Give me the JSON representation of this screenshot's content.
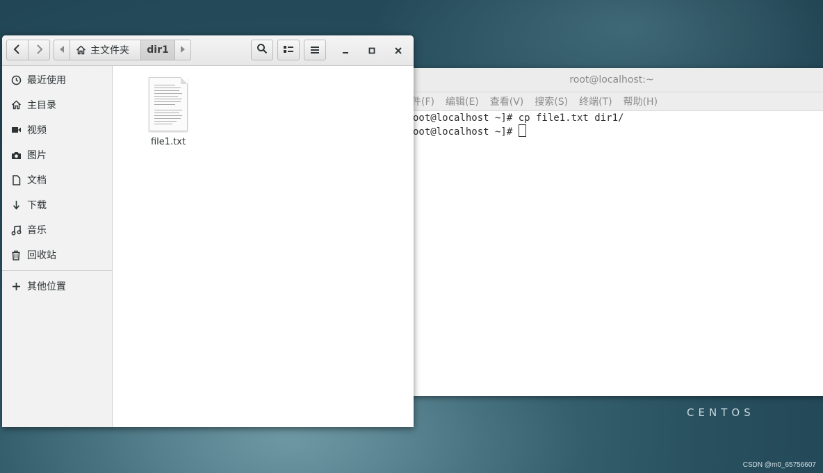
{
  "desktop": {
    "brand": "CENTOS",
    "watermark": "CSDN @m0_65756607"
  },
  "terminal": {
    "title": "root@localhost:~",
    "menu": [
      "件(F)",
      "编辑(E)",
      "查看(V)",
      "搜索(S)",
      "终端(T)",
      "帮助(H)"
    ],
    "lines": [
      "oot@localhost ~]# cp file1.txt dir1/",
      "oot@localhost ~]# "
    ]
  },
  "files": {
    "path": {
      "home_label": "主文件夹",
      "current": "dir1"
    },
    "sidebar": [
      {
        "label": "最近使用",
        "icon": "clock-icon"
      },
      {
        "label": "主目录",
        "icon": "home-icon"
      },
      {
        "label": "视频",
        "icon": "video-icon"
      },
      {
        "label": "图片",
        "icon": "camera-icon"
      },
      {
        "label": "文档",
        "icon": "document-icon"
      },
      {
        "label": "下载",
        "icon": "download-icon"
      },
      {
        "label": "音乐",
        "icon": "music-icon"
      },
      {
        "label": "回收站",
        "icon": "trash-icon"
      }
    ],
    "other_locations": "其他位置",
    "items": [
      {
        "name": "file1.txt",
        "icon": "text-file-icon"
      }
    ]
  }
}
